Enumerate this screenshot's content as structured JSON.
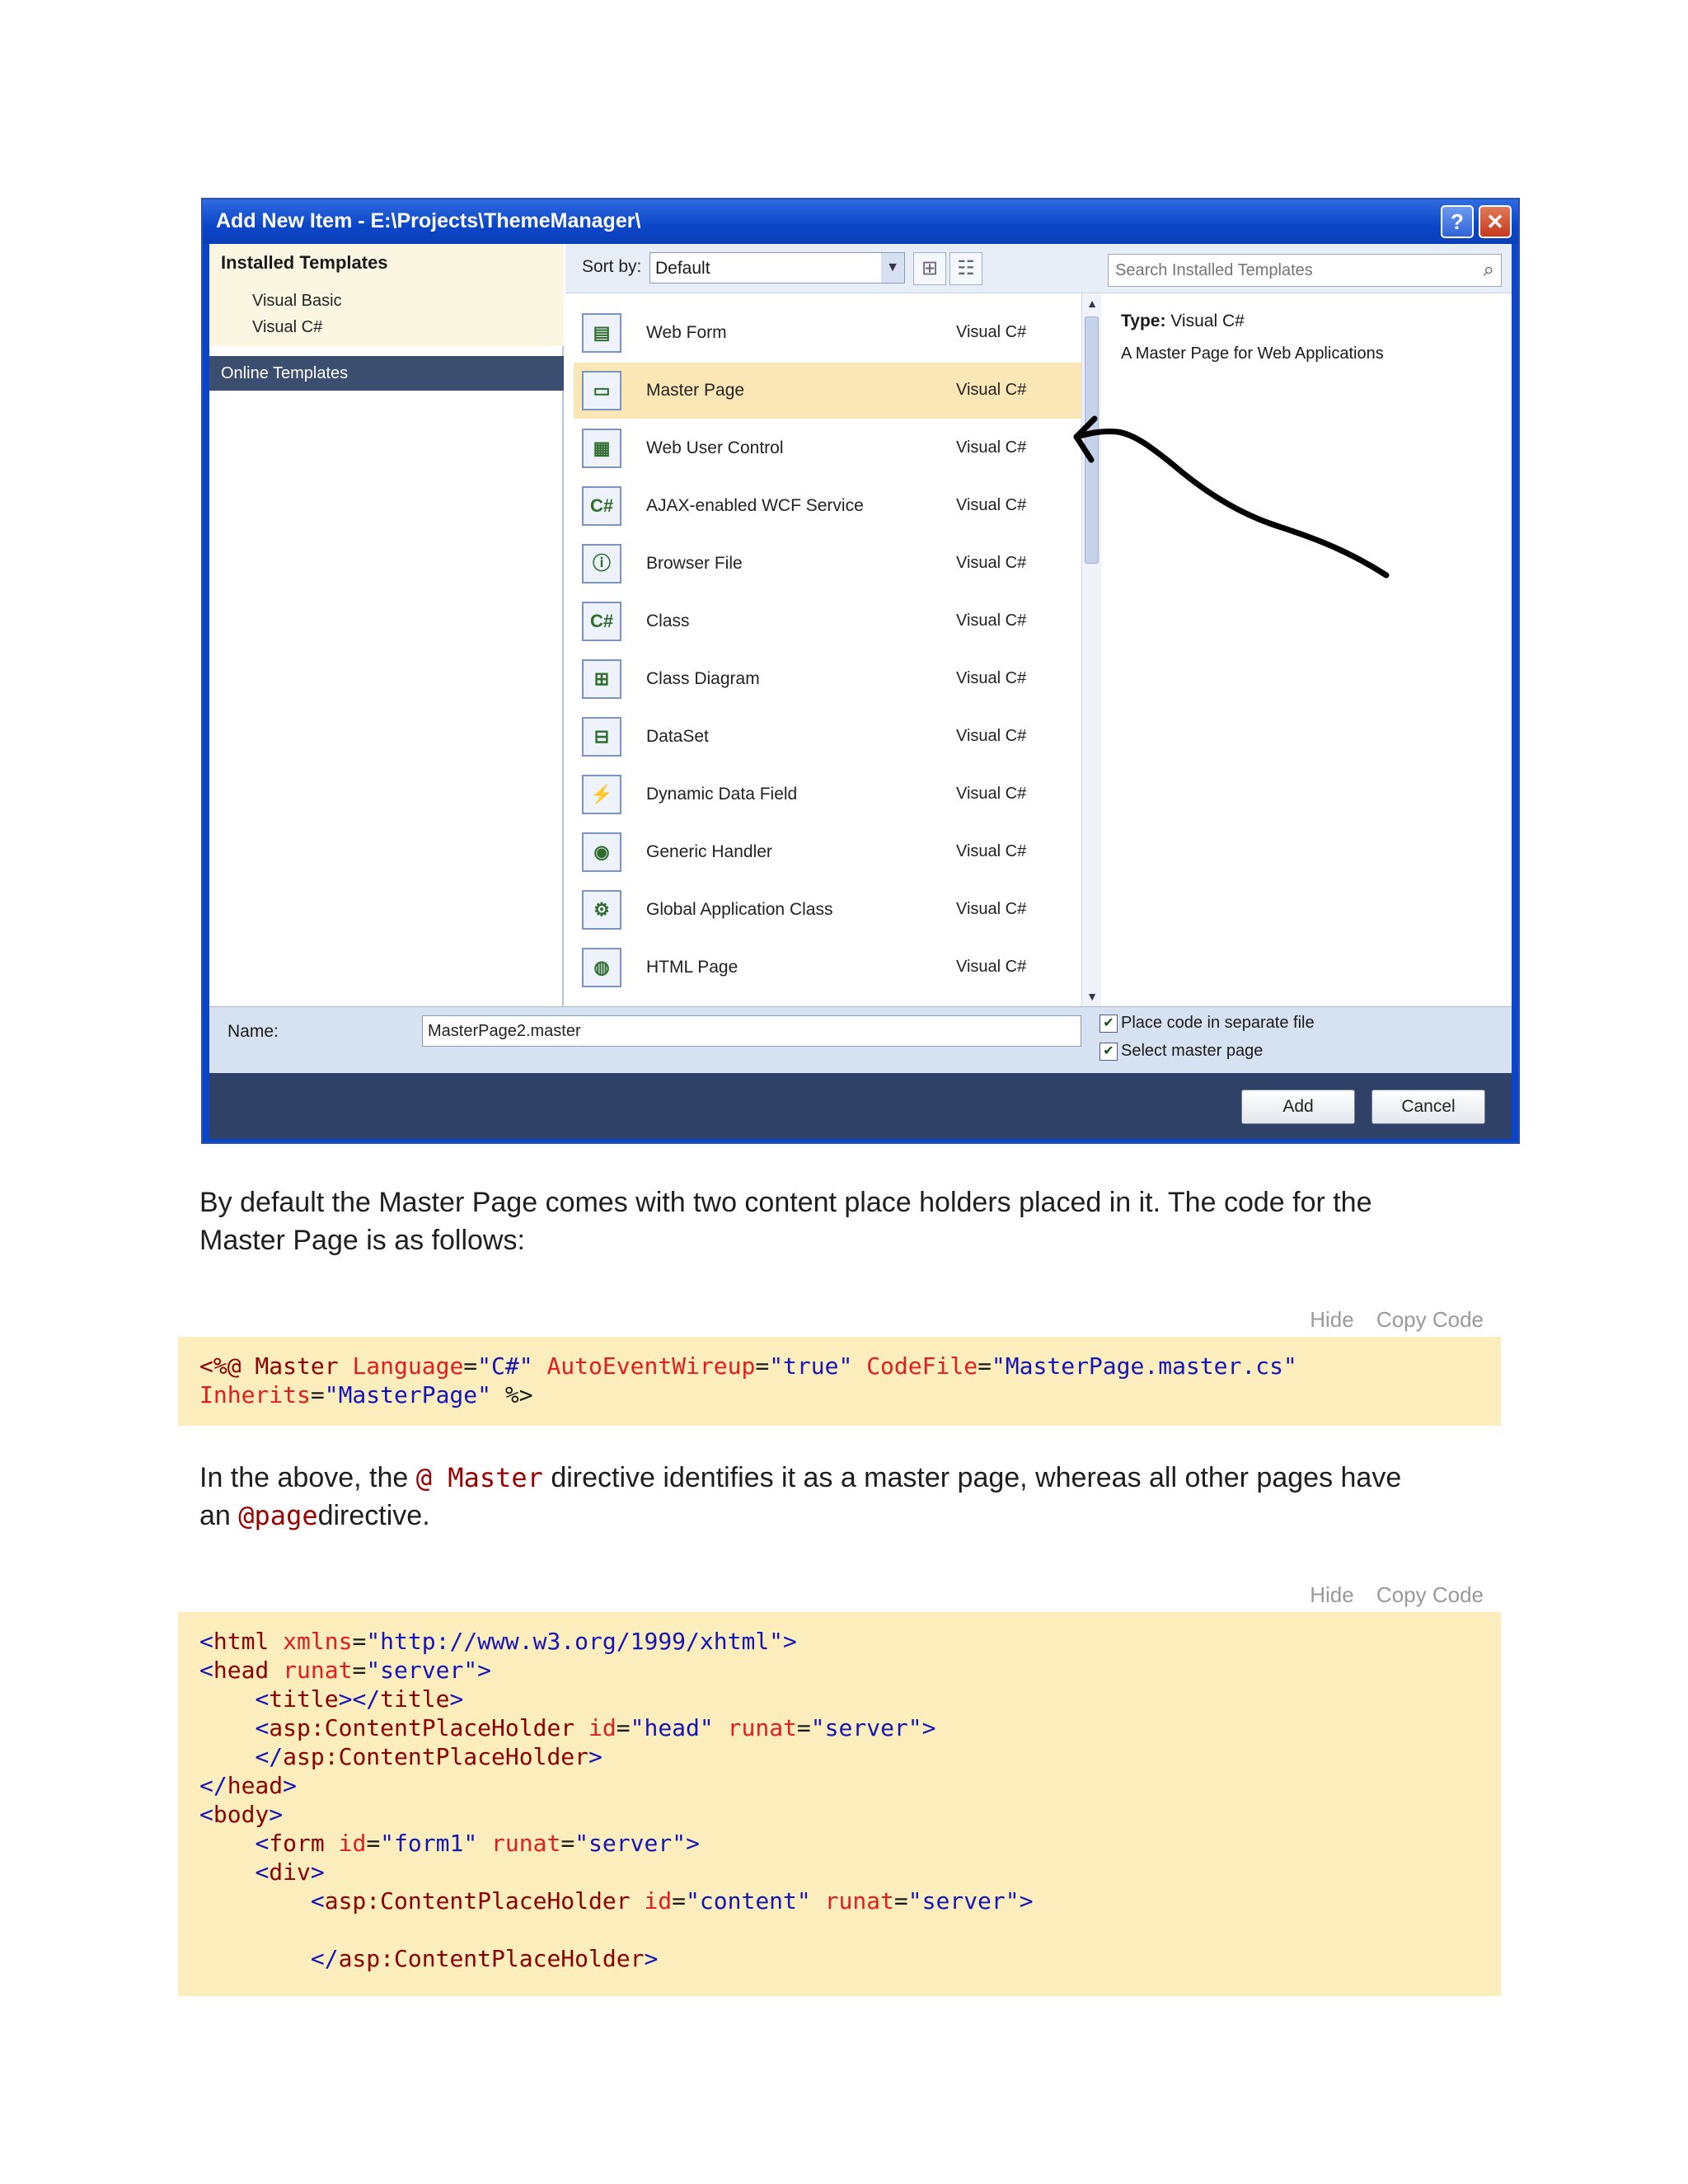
{
  "dialog": {
    "title": "Add New Item - E:\\Projects\\ThemeManager\\",
    "help_symbol": "?",
    "close_symbol": "✕",
    "installed_templates": "Installed Templates",
    "tree_items": [
      "Visual Basic",
      "Visual C#"
    ],
    "online_templates": "Online Templates",
    "sort_label": "Sort by:",
    "sort_value": "Default",
    "search_placeholder": "Search Installed Templates",
    "templates": [
      {
        "name": "Web Form",
        "lang": "Visual C#",
        "glyph": "▤"
      },
      {
        "name": "Master Page",
        "lang": "Visual C#",
        "glyph": "▭",
        "selected": true
      },
      {
        "name": "Web User Control",
        "lang": "Visual C#",
        "glyph": "▦"
      },
      {
        "name": "AJAX-enabled WCF Service",
        "lang": "Visual C#",
        "glyph": "C#"
      },
      {
        "name": "Browser File",
        "lang": "Visual C#",
        "glyph": "ⓘ"
      },
      {
        "name": "Class",
        "lang": "Visual C#",
        "glyph": "C#"
      },
      {
        "name": "Class Diagram",
        "lang": "Visual C#",
        "glyph": "⊞"
      },
      {
        "name": "DataSet",
        "lang": "Visual C#",
        "glyph": "⊟"
      },
      {
        "name": "Dynamic Data Field",
        "lang": "Visual C#",
        "glyph": "⚡"
      },
      {
        "name": "Generic Handler",
        "lang": "Visual C#",
        "glyph": "◉"
      },
      {
        "name": "Global Application Class",
        "lang": "Visual C#",
        "glyph": "⚙"
      },
      {
        "name": "HTML Page",
        "lang": "Visual C#",
        "glyph": "◍"
      }
    ],
    "info_type_label": "Type:",
    "info_type_value": "Visual C#",
    "info_description": "A Master Page for Web Applications",
    "name_label": "Name:",
    "name_value": "MasterPage2.master",
    "check_separate": "Place code in separate file",
    "check_master": "Select master page",
    "add_button": "Add",
    "cancel_button": "Cancel"
  },
  "article": {
    "para1_line1": "By default the Master Page comes with two content place holders placed in it. The code for the",
    "para1_line2": "Master Page is as follows:",
    "hide_label": "Hide",
    "copy_label": "Copy Code",
    "para2_before": "In the above, the ",
    "para2_code1": "@ Master",
    "para2_mid": " directive identifies it as a master page, whereas all other pages have",
    "para2_line2_before": "an ",
    "para2_code2": "@page",
    "para2_after": "directive."
  }
}
